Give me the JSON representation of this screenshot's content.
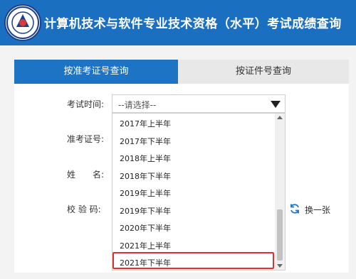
{
  "header": {
    "title": "计算机技术与软件专业技术资格（水平）考试成绩查询"
  },
  "tabs": [
    {
      "label": "按准考证号查询",
      "active": true
    },
    {
      "label": "按证件号查询",
      "active": false
    }
  ],
  "form": {
    "exam_time_label": "考试时间:",
    "exam_time_value": "--请选择--",
    "ticket_label": "准考证号:",
    "name_label": "姓　　名:",
    "captcha_label": "校 验 码:",
    "refresh_label": "换一张"
  },
  "dropdown": {
    "options": [
      "2017年上半年",
      "2017年下半年",
      "2018年上半年",
      "2018年下半年",
      "2019年上半年",
      "2019年下半年",
      "2020年下半年",
      "2021年上半年",
      "2021年下半年"
    ],
    "highlighted": "2021年下半年"
  },
  "colors": {
    "header": "#1b6fc0",
    "active_tab": "#1d73c4",
    "highlight": "#e03030"
  },
  "icons": {
    "logo": "emblem-logo",
    "refresh": "refresh-icon",
    "dropdown": "triangle-down-icon"
  }
}
